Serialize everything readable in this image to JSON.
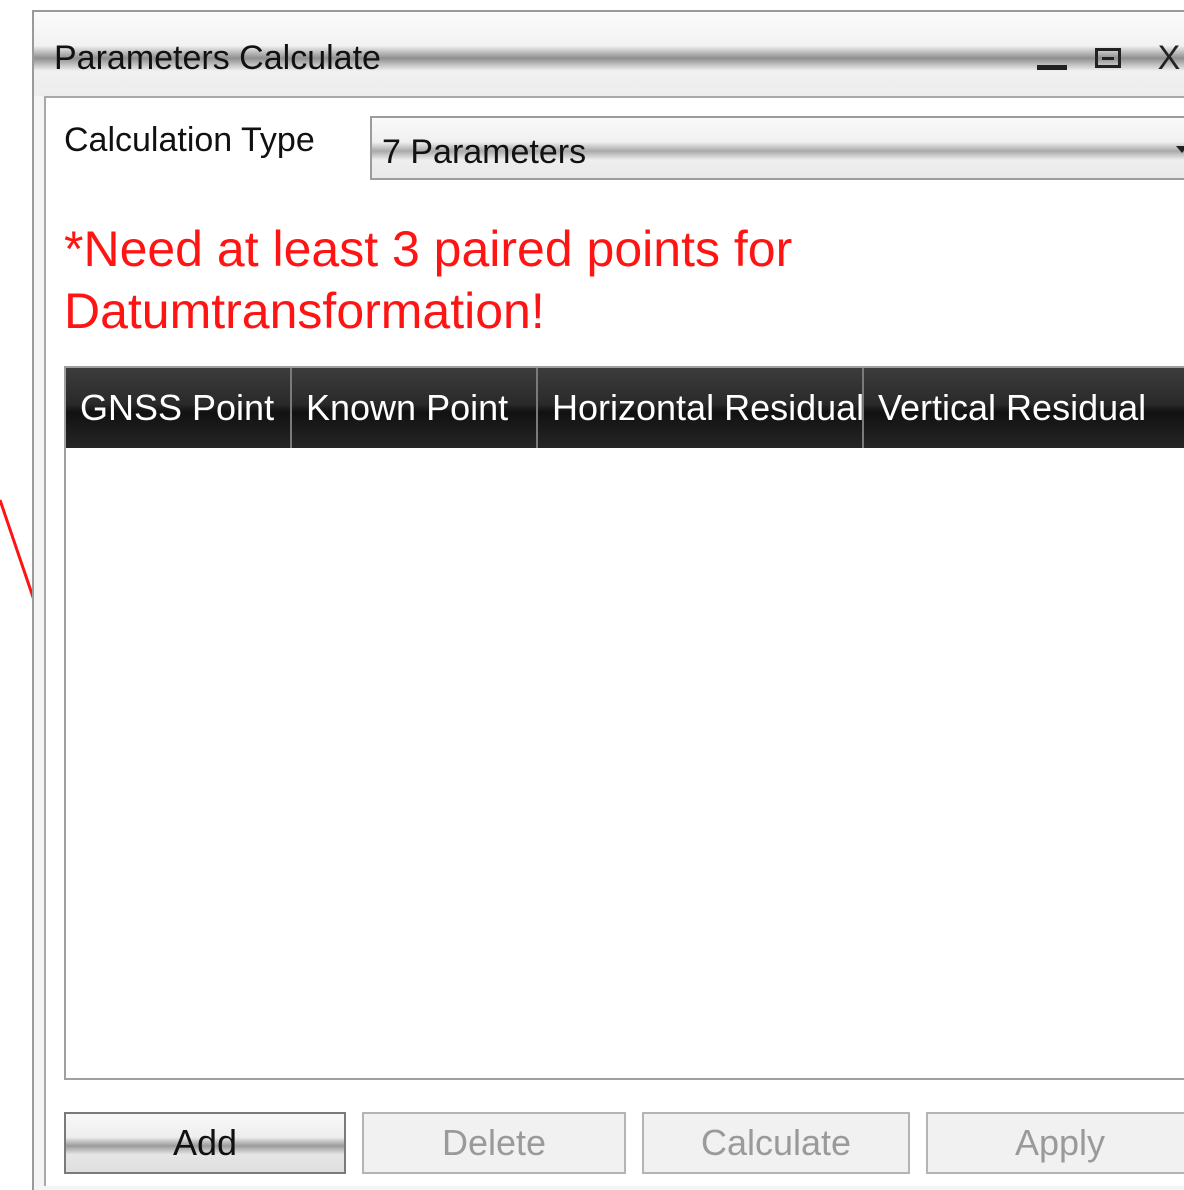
{
  "window": {
    "title": "Parameters Calculate",
    "controls": {
      "minimize_icon": "minimize-icon",
      "maximize_icon": "maximize-icon",
      "close_label": "X"
    }
  },
  "calculation_type": {
    "label": "Calculation Type",
    "selected": "7 Parameters",
    "arrow_icon": "chevron-down-icon"
  },
  "warning": {
    "text": "*Need at least 3 paired points for Datumtransformation!",
    "color": "#ff1414"
  },
  "table": {
    "columns": [
      "GNSS Point",
      "Known Point",
      "Horizontal Residual",
      "Vertical Residual"
    ],
    "rows": []
  },
  "buttons": {
    "add": "Add",
    "delete": "Delete",
    "calculate": "Calculate",
    "apply": "Apply"
  },
  "colors": {
    "header_bg": "#1e1e1e",
    "annotation_line": "#ff1414",
    "disabled_text": "#9a9a9a"
  }
}
